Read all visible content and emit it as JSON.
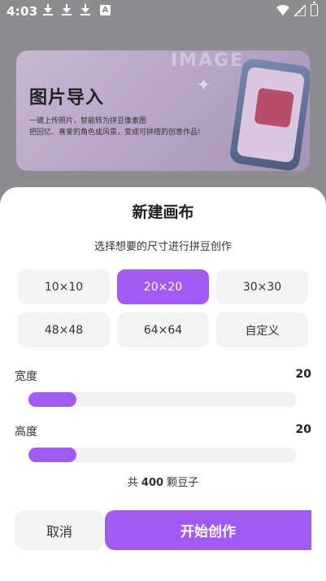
{
  "status_bar": {
    "time": "4:03",
    "a_badge": "A"
  },
  "background_banner": {
    "watermark": "IMAGE",
    "title": "图片导入",
    "desc_line1": "一键上传照片，智能转为拼豆像素图",
    "desc_line2": "把回忆、喜爱的角色或风景，变成可拼搭的创意作品!"
  },
  "sheet": {
    "title": "新建画布",
    "subtitle": "选择想要的尺寸进行拼豆创作",
    "size_options": [
      {
        "label": "10×10",
        "selected": false
      },
      {
        "label": "20×20",
        "selected": true
      },
      {
        "label": "30×30",
        "selected": false
      },
      {
        "label": "48×48",
        "selected": false
      },
      {
        "label": "64×64",
        "selected": false
      },
      {
        "label": "自定义",
        "selected": false
      }
    ],
    "width": {
      "label": "宽度",
      "value": "20",
      "fraction": 0.18
    },
    "height": {
      "label": "高度",
      "value": "20",
      "fraction": 0.18
    },
    "total_prefix": "共",
    "total_count": "400",
    "total_suffix": "颗豆子",
    "cancel_label": "取消",
    "start_label": "开始创作"
  },
  "colors": {
    "accent": "#a25bf2"
  }
}
